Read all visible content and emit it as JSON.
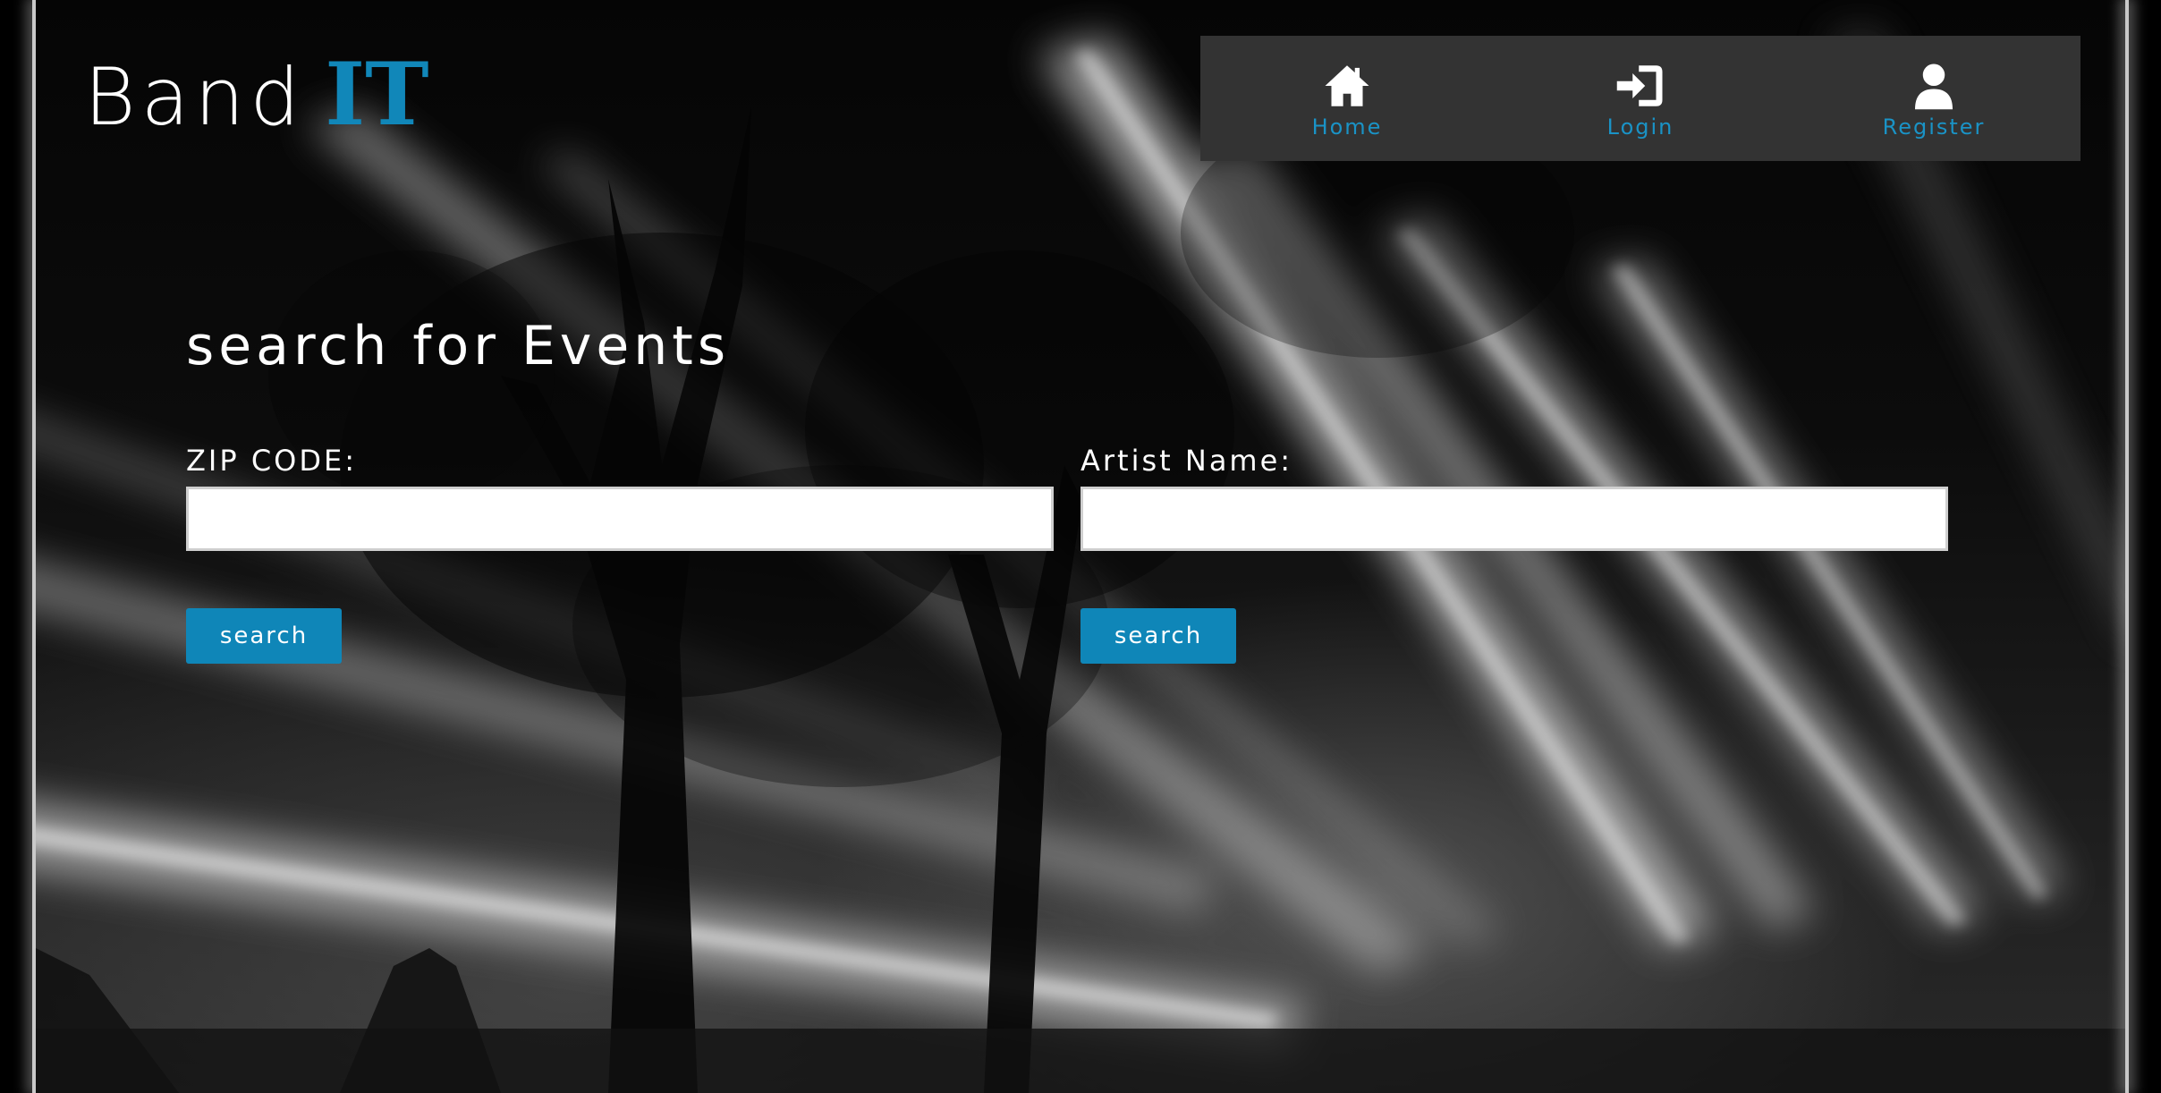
{
  "brand": {
    "name_part1": "Band",
    "name_part2": "IT",
    "accent_color": "#1187b9"
  },
  "nav": {
    "items": [
      {
        "label": "Home",
        "icon": "home-icon"
      },
      {
        "label": "Login",
        "icon": "login-icon"
      },
      {
        "label": "Register",
        "icon": "user-icon"
      }
    ],
    "background": "#333333",
    "label_color": "#1a93c6"
  },
  "search": {
    "title": "search for Events",
    "zip_label": "ZIP CODE:",
    "zip_value": "",
    "artist_label": "Artist Name:",
    "artist_value": "",
    "zip_button": "search",
    "artist_button": "search",
    "button_color": "#0f86b8"
  }
}
